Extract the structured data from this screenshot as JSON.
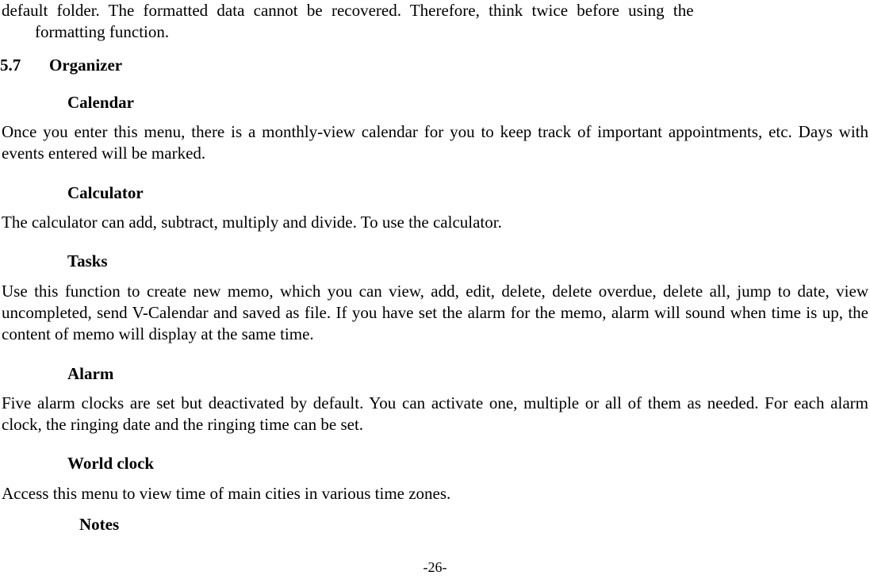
{
  "intro": {
    "line1": "default folder. The formatted data cannot be recovered. Therefore, think twice before using the",
    "line2": "formatting function."
  },
  "section": {
    "number": "5.7",
    "title": "Organizer"
  },
  "calendar": {
    "heading": "Calendar",
    "body": "Once you enter this menu, there is a monthly-view calendar for you to keep track of important appointments, etc. Days with events entered will be marked."
  },
  "calculator": {
    "heading": "Calculator",
    "body": "The calculator can add, subtract, multiply and divide. To use the calculator."
  },
  "tasks": {
    "heading": "Tasks",
    "body": "Use this function to create new memo, which you can view, add, edit, delete, delete overdue, delete all, jump to date, view uncompleted, send V-Calendar and saved as file. If you have set the alarm for the memo, alarm will sound when time is up, the content of memo will display at the same time."
  },
  "alarm": {
    "heading": "Alarm",
    "body": "Five alarm clocks are set but deactivated by default. You can activate one, multiple or all of them as needed. For each alarm clock, the ringing date and the ringing time can be set."
  },
  "worldclock": {
    "heading": "World clock",
    "body": "Access this menu to view time of main cities in various time zones."
  },
  "notes": {
    "heading": "Notes"
  },
  "pageNumber": "-26-"
}
